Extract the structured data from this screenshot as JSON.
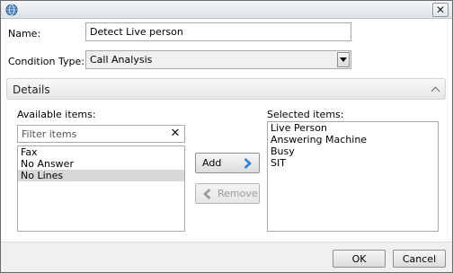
{
  "window": {
    "close_glyph": "✕",
    "icon": "globe-icon"
  },
  "form": {
    "name_label": "Name:",
    "name_value": "Detect Live person",
    "condition_type_label": "Condition Type:",
    "condition_type_value": "Call Analysis"
  },
  "details": {
    "header": "Details",
    "available_label": "Available items:",
    "filter_placeholder": "Filter items",
    "clear_glyph": "✕",
    "available_items": [
      "Fax",
      "No Answer",
      "No Lines"
    ],
    "selected_available_index": 2,
    "add_label": "Add",
    "remove_label": "Remove",
    "selected_label": "Selected items:",
    "selected_items": [
      "Live Person",
      "Answering Machine",
      "Busy",
      "SIT"
    ]
  },
  "footer": {
    "ok_label": "OK",
    "cancel_label": "Cancel"
  },
  "colors": {
    "accent_arrow": "#2f7fd8",
    "disabled_arrow": "#9a9a9a"
  }
}
